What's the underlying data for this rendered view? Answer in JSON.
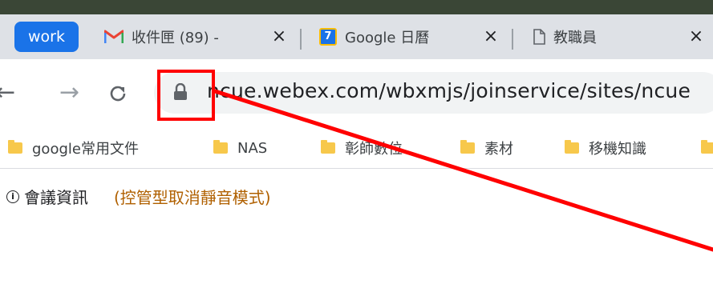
{
  "tab_group": {
    "label": "work",
    "color": "#1a73e8"
  },
  "tabs": [
    {
      "title": "收件匣 (89) -",
      "icon": "gmail-icon"
    },
    {
      "title": "Google 日曆",
      "icon": "google-calendar-icon",
      "icon_text": "7"
    },
    {
      "title": "教職員",
      "icon": "page-icon"
    }
  ],
  "close_glyph": "×",
  "toolbar": {
    "url": "ncue.webex.com/wbxmjs/joinservice/sites/ncue"
  },
  "bookmarks": [
    "google常用文件",
    "NAS",
    "彰師數位",
    "素材",
    "移機知識"
  ],
  "page": {
    "info_label": "會議資訊",
    "mode_text": "(控管型取消靜音模式)"
  },
  "annotation": {
    "color": "#ff0000"
  }
}
